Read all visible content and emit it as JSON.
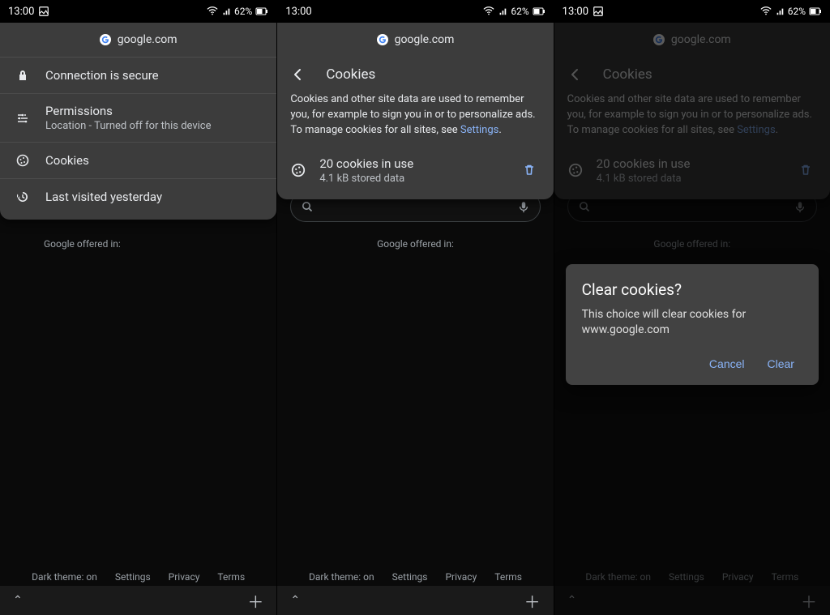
{
  "status": {
    "time": "13:00",
    "battery": "62%"
  },
  "site": {
    "domain": "google.com"
  },
  "info_panel": {
    "connection": "Connection is secure",
    "permissions_title": "Permissions",
    "permissions_sub": "Location - Turned off for this device",
    "cookies": "Cookies",
    "last_visited": "Last visited yesterday"
  },
  "cookies_panel": {
    "title": "Cookies",
    "desc_pre": "Cookies and other site data are used to remember you, for example to sign you in or to personalize ads. To manage cookies for all sites, see ",
    "desc_link": "Settings",
    "desc_post": ".",
    "count_line": "20 cookies in use",
    "size_line": "4.1 kB stored data"
  },
  "dialog": {
    "title": "Clear cookies?",
    "body": "This choice will clear cookies for www.google.com",
    "cancel": "Cancel",
    "clear": "Clear"
  },
  "bg": {
    "offered": "Google offered in:",
    "dark_theme": "Dark theme: on",
    "settings": "Settings",
    "privacy": "Privacy",
    "terms": "Terms"
  }
}
